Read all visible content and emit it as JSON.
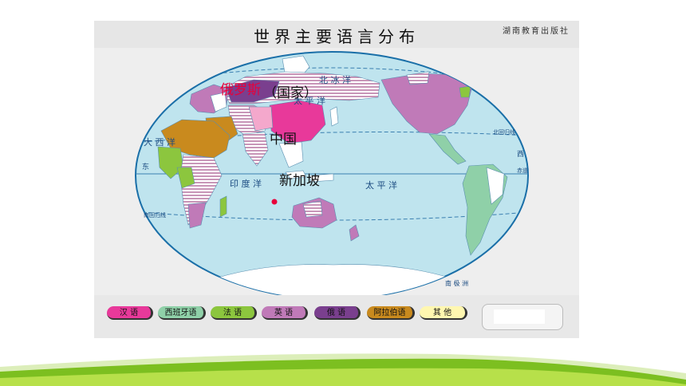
{
  "title": "世界主要语言分布",
  "publisher": "湖南教育出版社",
  "map_labels": {
    "north_ice": "北 冰 洋",
    "atlantic": "大 西 洋",
    "indian": "印 度 洋",
    "pacific_n": "太 平 洋",
    "pacific_s": "太 平 洋",
    "tropic_n": "北回归线",
    "tropic_s": "南回归线",
    "antarctica": "南 极 洲",
    "west_edge": "西",
    "east_edge": "东",
    "equator_east": "赤道"
  },
  "overlay": {
    "russia": "俄罗斯",
    "country_note": "（国家）",
    "china": "中国",
    "singapore": "新加坡"
  },
  "legend": [
    {
      "label": "汉 语",
      "color": "#e8399a"
    },
    {
      "label": "西班牙语",
      "color": "#8fd0a8"
    },
    {
      "label": "法 语",
      "color": "#8cc63e"
    },
    {
      "label": "英 语",
      "color": "#c07ab8"
    },
    {
      "label": "俄 语",
      "color": "#7a3f8e"
    },
    {
      "label": "阿拉伯语",
      "color": "#c98a1e"
    },
    {
      "label": "其 他",
      "color": "#fff7b0"
    }
  ],
  "colors": {
    "ocean": "#bfe4ee",
    "ocean_edge": "#1a6fa8",
    "chinese": "#e8399a",
    "spanish": "#8fd0a8",
    "french": "#8cc63e",
    "english": "#c07ab8",
    "russian": "#7a3f8e",
    "arabic": "#c98a1e",
    "other": "#fff7b0",
    "stripe": "#c896b8"
  }
}
